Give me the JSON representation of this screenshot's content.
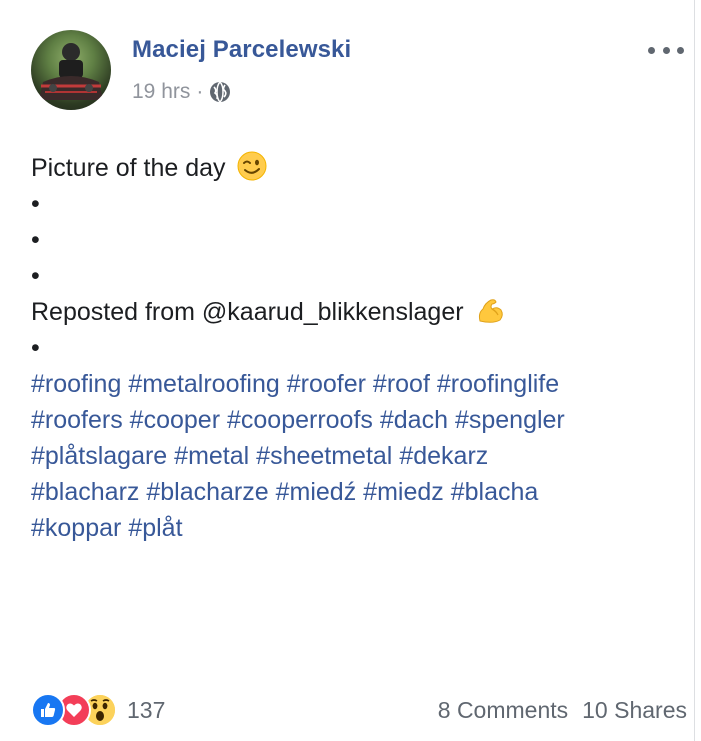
{
  "post": {
    "author": "Maciej Parcelewski",
    "time": "19 hrs",
    "separator": "·",
    "privacy_icon": "globe-icon",
    "more_icon": "ellipsis-icon",
    "lines": [
      "Picture of the day",
      "•",
      "•",
      "•",
      "Reposted from @kaarud_blikkenslager",
      "•"
    ],
    "line_emojis": [
      "wink-emoji",
      "",
      "",
      "",
      "flexed-biceps-emoji",
      ""
    ],
    "hashtag_lines": [
      [
        "#roofing",
        "#metalroofing",
        "#roofer",
        "#roof",
        "#roofinglife"
      ],
      [
        "#roofers",
        "#cooper",
        "#cooperroofs",
        "#dach",
        "#spengler"
      ],
      [
        "#plåtslagare",
        "#metal",
        "#sheetmetal",
        "#dekarz"
      ],
      [
        "#blacharz",
        "#blacharze",
        "#miedź",
        "#miedz",
        "#blacha"
      ],
      [
        "#koppar",
        "#plåt"
      ]
    ]
  },
  "footer": {
    "reactions": [
      "like-reaction-icon",
      "love-reaction-icon",
      "wow-reaction-icon"
    ],
    "reaction_count": "137",
    "comments": "8 Comments",
    "shares": "10 Shares"
  },
  "colors": {
    "link": "#385898",
    "text": "#1c1e21",
    "meta": "#90949c",
    "like": "#1877f2",
    "love": "#f33e58",
    "wow": "#fcd25b"
  }
}
